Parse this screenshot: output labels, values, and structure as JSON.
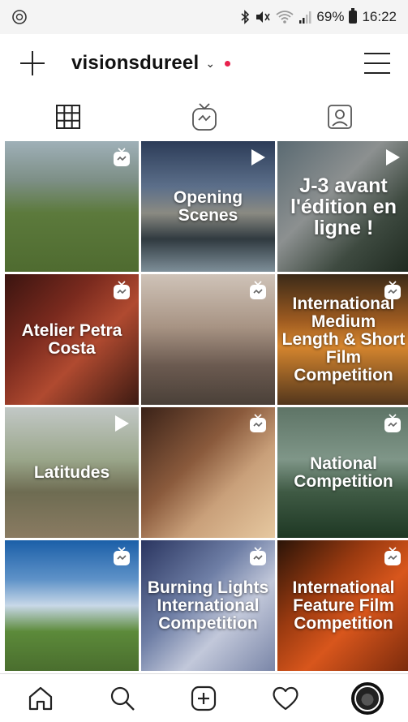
{
  "status_bar": {
    "left_icon": "whatsapp-icon",
    "battery_percent": "69%",
    "time": "16:22",
    "icons": [
      "bluetooth-icon",
      "mute-icon",
      "wifi-icon",
      "signal-icon",
      "battery-icon"
    ]
  },
  "header": {
    "username": "visionsdureel",
    "notification_dot_color": "#e8224d"
  },
  "tabs": [
    {
      "icon": "grid-icon"
    },
    {
      "icon": "igtv-icon"
    },
    {
      "icon": "tagged-icon"
    }
  ],
  "posts": [
    {
      "text": "",
      "badge": "igtv",
      "bg": "linear-gradient(180deg,#9fb0b8 0%,#7d8f86 30%,#5c7a3c 55%,#4f6b30 100%)"
    },
    {
      "text": "Opening Scenes",
      "badge": "video",
      "bg": "linear-gradient(180deg,#2c3c58 0%,#5c6f8a 35%,#8a8a82 55%,#303a40 75%,#7e8f99 100%)"
    },
    {
      "text": "J-3 avant l'édition en ligne !",
      "big": true,
      "badge": "video",
      "bg": "linear-gradient(135deg,#5a6a72 0%,#8c9090 40%,#3e4a40 70%,#1f2a20 100%)"
    },
    {
      "text": "Atelier Petra Costa",
      "badge": "igtv",
      "bg": "linear-gradient(135deg,#3a1410 0%,#7a2a1e 35%,#b04a30 60%,#3c1a12 100%)"
    },
    {
      "text": "",
      "badge": "igtv",
      "bg": "linear-gradient(180deg,#cfc3b8 0%,#a89484 40%,#6b5a50 70%,#4a4038 100%)"
    },
    {
      "text": "International Medium Length & Short Film Competition",
      "badge": "igtv",
      "bg": "linear-gradient(180deg,#3b2a18 0%,#9c5a20 35%,#d6862e 55%,#52361c 100%)"
    },
    {
      "text": "Latitudes",
      "badge": "video",
      "bg": "linear-gradient(180deg,#c2c8c6 0%,#9aa68a 40%,#6e6c52 65%,#8a7b62 100%)"
    },
    {
      "text": "",
      "badge": "igtv",
      "bg": "linear-gradient(135deg,#3a2218 0%,#8a5a3c 40%,#c9a07a 65%,#e6c8a0 100%)"
    },
    {
      "text": "National Competition",
      "badge": "igtv",
      "bg": "linear-gradient(180deg,#5e7466 0%,#7f9688 40%,#3f5a44 65%,#1e3824 100%)"
    },
    {
      "text": "",
      "badge": "igtv",
      "bg": "linear-gradient(180deg,#1b5fa8 0%,#5e92c8 30%,#c8d8e8 50%,#5c8a3a 70%,#4a6e2e 100%)"
    },
    {
      "text": "Burning Lights International Competition",
      "badge": "igtv",
      "bg": "linear-gradient(135deg,#2a3560 0%,#6f7fa6 40%,#c2c8da 65%,#7a86a8 100%)"
    },
    {
      "text": "International Feature Film Competition",
      "badge": "igtv",
      "bg": "linear-gradient(135deg,#2a1408 0%,#9a3a10 35%,#d8561c 60%,#7a2a0c 100%)"
    }
  ],
  "bottom_nav": [
    {
      "name": "home",
      "icon": "home-icon"
    },
    {
      "name": "search",
      "icon": "search-icon"
    },
    {
      "name": "new-post",
      "icon": "add-post-icon"
    },
    {
      "name": "activity",
      "icon": "heart-icon"
    },
    {
      "name": "profile",
      "icon": "avatar"
    }
  ]
}
